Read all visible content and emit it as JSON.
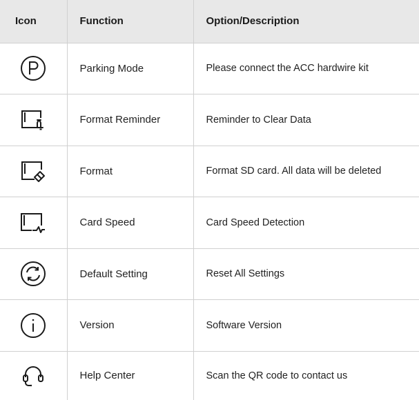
{
  "headers": {
    "icon": "Icon",
    "function": "Function",
    "description": "Option/Description"
  },
  "rows": [
    {
      "icon": "parking-p-icon",
      "function": "Parking Mode",
      "description": "Please connect the ACC hardwire kit"
    },
    {
      "icon": "sd-card-bell-icon",
      "function": "Format Reminder",
      "description": "Reminder to Clear Data"
    },
    {
      "icon": "sd-card-eraser-icon",
      "function": "Format",
      "description": "Format SD card. All data will be deleted"
    },
    {
      "icon": "sd-card-pulse-icon",
      "function": "Card Speed",
      "description": "Card Speed Detection"
    },
    {
      "icon": "reset-circle-icon",
      "function": "Default Setting",
      "description": "Reset All Settings"
    },
    {
      "icon": "info-circle-icon",
      "function": "Version",
      "description": "Software Version"
    },
    {
      "icon": "headset-icon",
      "function": "Help Center",
      "description": "Scan the QR code to contact us"
    }
  ],
  "colors": {
    "header_bg": "#e8e8e8",
    "border": "#d0d0d0",
    "text": "#1f1f1f",
    "icon_stroke": "#1a1a1a"
  }
}
